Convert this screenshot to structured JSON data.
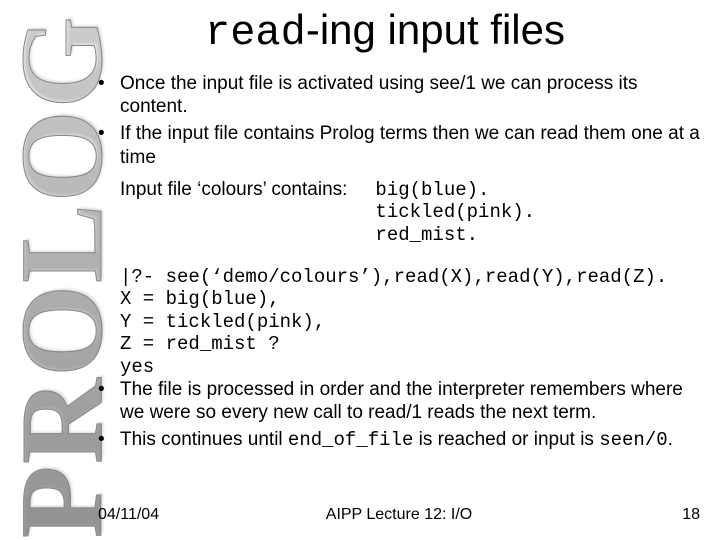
{
  "sidebar": {
    "text": "PROLOG"
  },
  "title": {
    "mono": "read",
    "rest": "-ing input files"
  },
  "bullets_top": [
    "Once the input file is activated using see/1 we can process its content.",
    "If the input file contains Prolog terms then we can read them one at a time"
  ],
  "input_label": "Input file ‘colours’ contains:",
  "input_lines": [
    "big(blue).",
    "tickled(pink).",
    "red_mist."
  ],
  "query_lines": [
    "|?- see(‘demo/colours’),read(X),read(Y),read(Z).",
    "X = big(blue),",
    "Y = tickled(pink),",
    "Z = red_mist ?",
    "yes"
  ],
  "bullets_bottom": [
    {
      "pre": "The file is processed in order and the interpreter remembers where we were so every new call to read/1 reads the next term."
    },
    {
      "pre": "This continues until ",
      "mono1": "end_of_file",
      "mid": " is reached or input is ",
      "mono2": "seen/0",
      "post": "."
    }
  ],
  "footer": {
    "date": "04/11/04",
    "center": "AIPP Lecture 12: I/O",
    "page": "18"
  }
}
